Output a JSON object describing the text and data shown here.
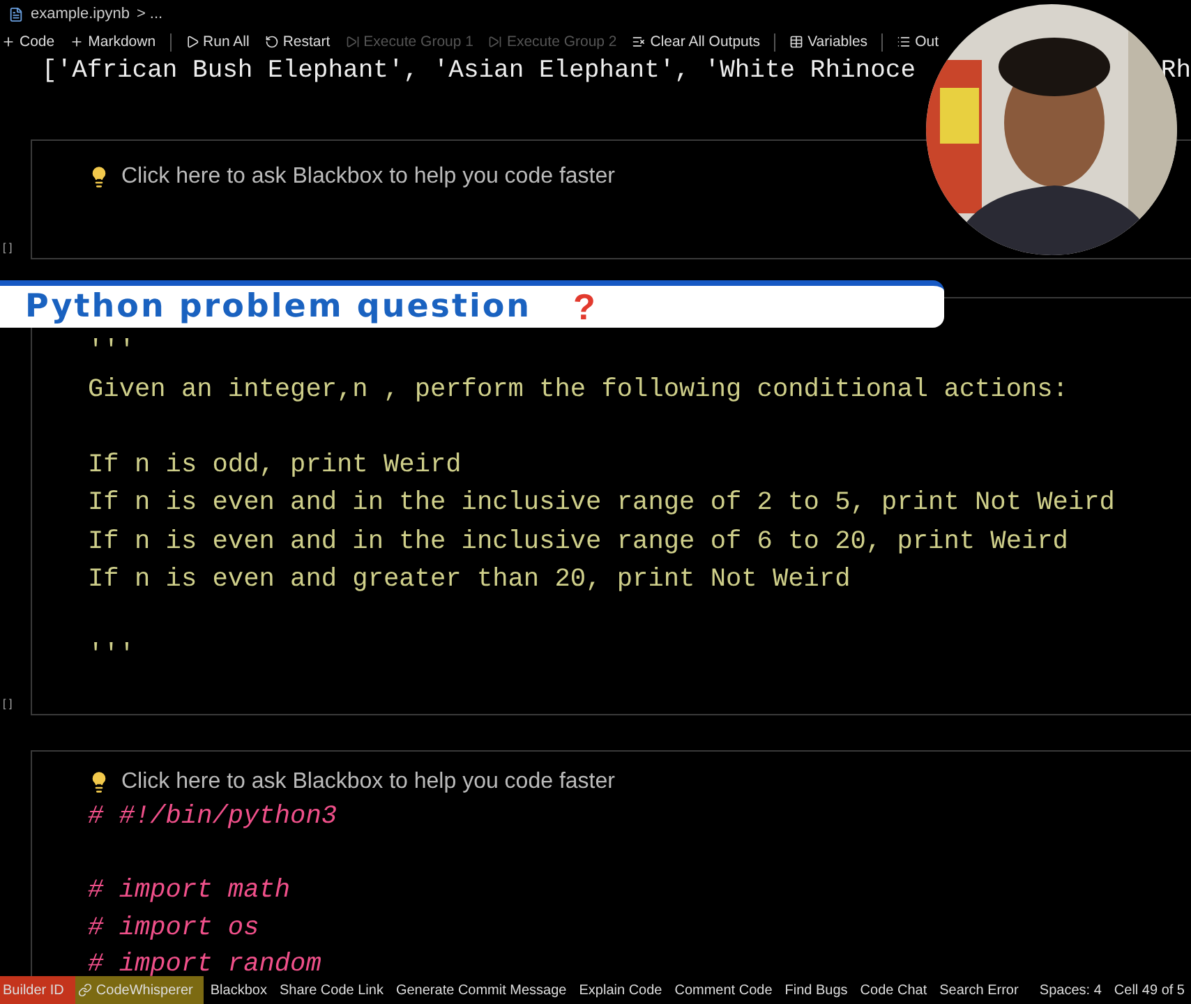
{
  "breadcrumb": {
    "file": "example.ipynb",
    "rest": "> ..."
  },
  "toolbar": [
    {
      "label": "Code",
      "disabled": false
    },
    {
      "label": "Markdown",
      "disabled": false
    },
    {
      "label": "Run All",
      "disabled": false
    },
    {
      "label": "Restart",
      "disabled": false
    },
    {
      "label": "Execute Group 1",
      "disabled": true
    },
    {
      "label": "Execute Group 2",
      "disabled": true
    },
    {
      "label": "Clear All Outputs",
      "disabled": false
    },
    {
      "label": "Variables",
      "disabled": false
    },
    {
      "label": "Out",
      "disabled": false
    }
  ],
  "output": {
    "text": "['African Bush Elephant', 'Asian Elephant', 'White Rhinoce",
    "tail": "Rh"
  },
  "banner": {
    "text": "Python problem question",
    "mark": "?"
  },
  "cells": [
    {
      "kind": "empty",
      "hint": "Click here to ask Blackbox to help you code faster",
      "gutter": "[ ]"
    },
    {
      "kind": "docstring",
      "gutter": "[ ]",
      "blocks": [
        [
          "'''",
          "Given an integer,n , perform the following conditional actions:"
        ],
        [
          "If n is odd, print Weird",
          "If n is even and in the inclusive range of 2 to 5, print Not Weird",
          "If n is even and in the inclusive range of 6 to 20, print Weird",
          "If n is even and greater than 20, print Not Weird"
        ],
        [
          "'''"
        ]
      ]
    },
    {
      "kind": "comment",
      "hint": "Click here to ask Blackbox to help you code faster",
      "blocks": [
        [
          "# #!/bin/python3"
        ],
        [
          "# import math",
          "# import os",
          "# import random"
        ]
      ]
    }
  ],
  "status_bar": {
    "left": [
      {
        "label": "Builder ID",
        "color": "#c4341c"
      },
      {
        "label": "CodeWhisperer",
        "color": "#7c6a12"
      },
      {
        "label": "Blackbox"
      },
      {
        "label": "Share Code Link"
      },
      {
        "label": "Generate Commit Message"
      },
      {
        "label": "Explain Code"
      },
      {
        "label": "Comment Code"
      },
      {
        "label": "Find Bugs"
      },
      {
        "label": "Code Chat"
      },
      {
        "label": "Search Error"
      }
    ],
    "right": [
      {
        "label": "Spaces: 4"
      },
      {
        "label": "Cell 49 of 5"
      }
    ]
  }
}
